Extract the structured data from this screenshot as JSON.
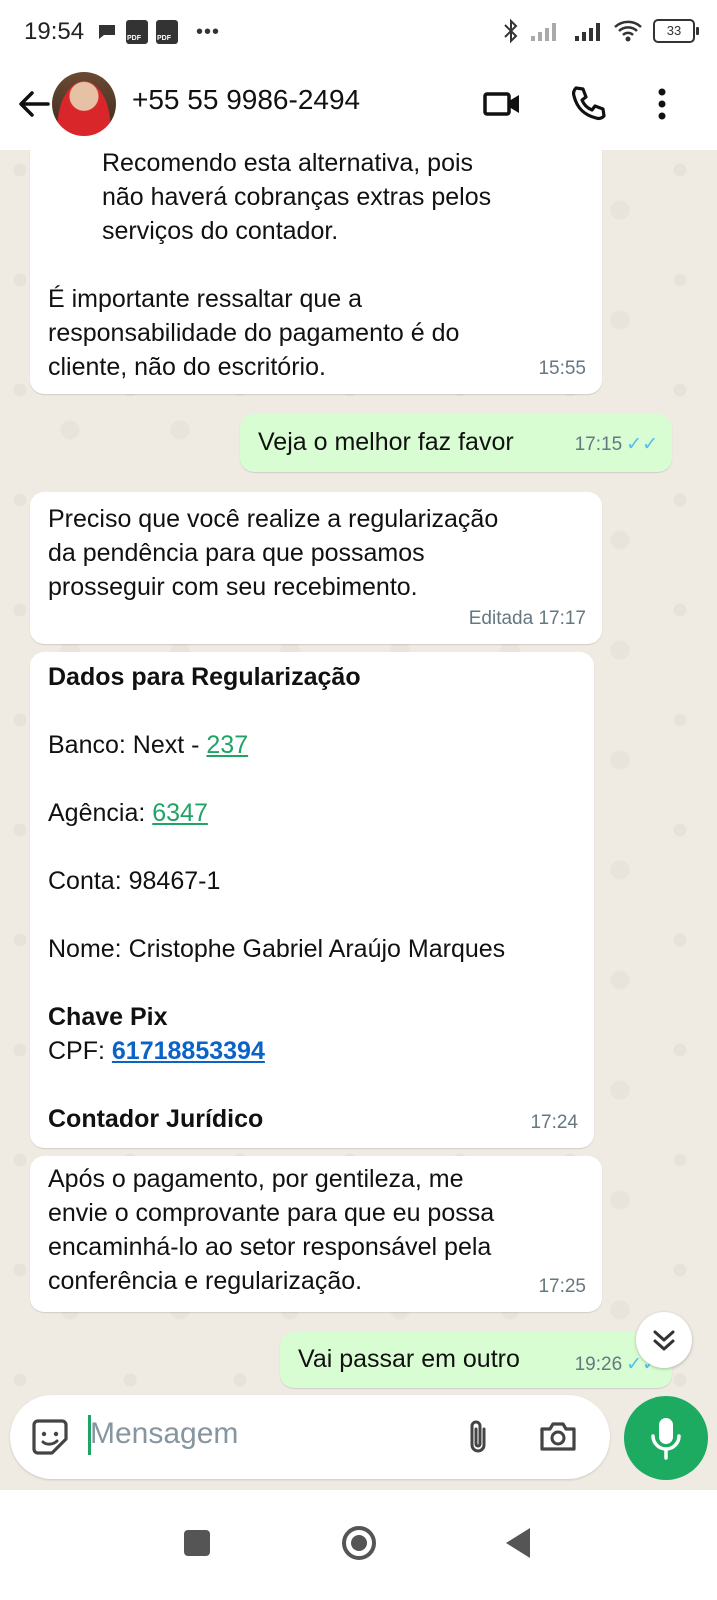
{
  "status_bar": {
    "time": "19:54",
    "battery": "33"
  },
  "header": {
    "contact_name": "+55 55 9986-2494"
  },
  "messages": [
    {
      "direction": "in",
      "indented_text": [
        "Recomendo esta alternativa, pois",
        "não haverá cobranças extras pelos",
        "serviços do contador."
      ],
      "text": [
        "É importante ressaltar que a",
        "responsabilidade do pagamento é do",
        "cliente, não do escritório."
      ],
      "time": "15:55"
    },
    {
      "direction": "out",
      "text": "Veja o melhor faz favor",
      "time": "17:15",
      "ticks": "✓✓"
    },
    {
      "direction": "in",
      "text": [
        "Preciso que você realize a regularização",
        "da pendência para que possamos",
        "prosseguir com seu recebimento."
      ],
      "time": "Editada 17:17"
    },
    {
      "direction": "in",
      "title": "Dados para Regularização",
      "banco_label": "Banco: Next - ",
      "banco_code": "237",
      "agencia_label": "Agência: ",
      "agencia_code": "6347",
      "conta": "Conta: 98467-1",
      "nome": "Nome: Cristophe Gabriel Araújo Marques",
      "pix_title": "Chave Pix",
      "cpf_label": "CPF: ",
      "cpf_value": "61718853394",
      "footer": "Contador Jurídico",
      "time": "17:24"
    },
    {
      "direction": "in",
      "text": [
        "Após o pagamento, por gentileza, me",
        "envie o comprovante para que eu possa",
        "encaminhá-lo ao setor responsável pela",
        "conferência e regularização."
      ],
      "time": "17:25"
    },
    {
      "direction": "out",
      "text": "Vai passar em outro",
      "time": "19:26",
      "ticks": "✓✓"
    }
  ],
  "input": {
    "placeholder": "Mensagem"
  },
  "colors": {
    "outgoing_bubble": "#d9fdd3",
    "link_green": "#21a366",
    "link_blue": "#0b63c7",
    "mic_button": "#1daa61",
    "chat_background": "#efeae2"
  },
  "icons": {
    "back": "arrow-left",
    "video_call": "video-camera",
    "voice_call": "phone",
    "menu": "more-vertical",
    "emoji": "sticker-smile",
    "attach": "paperclip",
    "camera": "camera",
    "mic": "microphone",
    "scroll_down": "double-chevron-down"
  }
}
